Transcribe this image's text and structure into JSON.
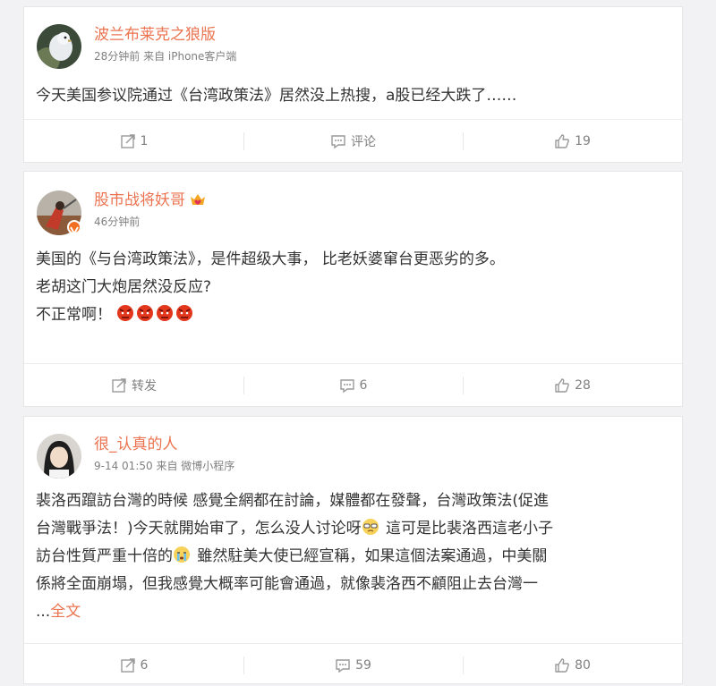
{
  "posts": [
    {
      "username": "波兰布莱克之狼版",
      "meta": "28分钟前 来自 iPhone客户端",
      "lines": [
        "今天美国参议院通过《台湾政策法》居然没上热搜，a股已经大跌了……"
      ],
      "actions": {
        "repost": "1",
        "comment": "评论",
        "like": "19"
      }
    },
    {
      "username": "股市战将妖哥",
      "meta": "46分钟前",
      "lines": [
        "美国的《与台湾政策法》，是件超级大事， 比老妖婆窜台更恶劣的多。",
        "老胡这门大炮居然没反应?",
        "不正常啊！"
      ],
      "actions": {
        "repost": "转发",
        "comment": "6",
        "like": "28"
      }
    },
    {
      "username": "很_认真的人",
      "meta": "9-14 01:50 来自 微博小程序",
      "lines": [
        "裴洛西躥訪台灣的時候 感覺全網都在討論，媒體都在發聲，台灣政策法(促進",
        "台灣戰爭法！)今天就開始审了，怎么没人讨论呀",
        " 這可是比裴洛西這老小子",
        "訪台性質严重十倍的",
        " 雖然駐美大使已經宣稱，如果這個法案通過，中美關",
        "係將全面崩塌，但我感覺大概率可能會通過，就像裴洛西不顧阻止去台灣一",
        "..."
      ],
      "full_text_link": "全文",
      "actions": {
        "repost": "6",
        "comment": "59",
        "like": "80"
      }
    }
  ],
  "colors": {
    "accent": "#eb7350",
    "meta": "#808080",
    "text": "#333333"
  },
  "icons": [
    "repost-icon",
    "comment-icon",
    "like-icon",
    "angry-emoji-icon",
    "sunglasses-emoji-icon",
    "crying-emoji-icon",
    "vip-crown-icon",
    "verified-badge-icon"
  ]
}
